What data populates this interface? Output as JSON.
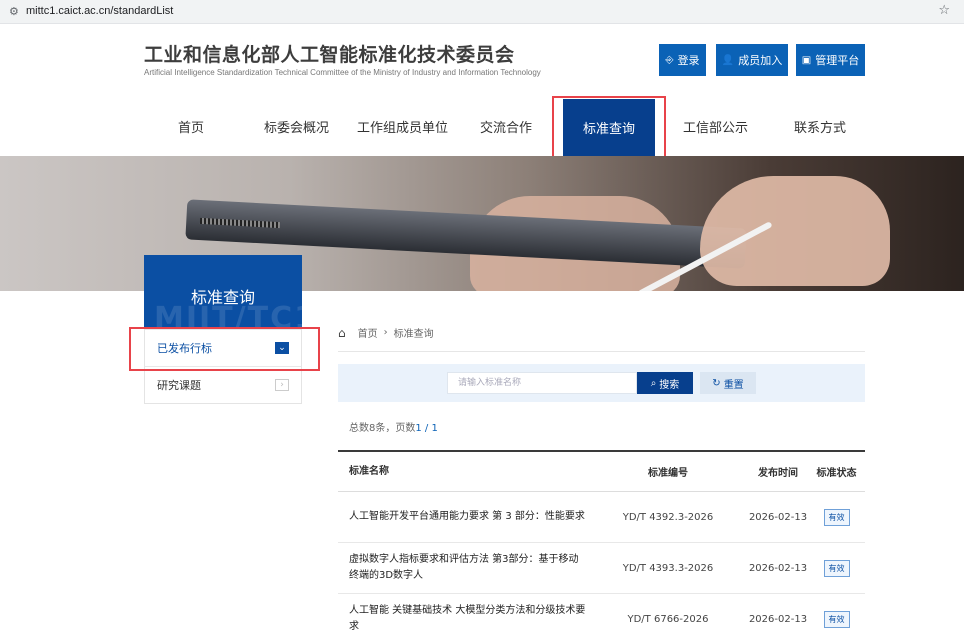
{
  "browser": {
    "url": "mittc1.caict.ac.cn/standardList"
  },
  "header": {
    "title": "工业和信息化部人工智能标准化技术委员会",
    "subtitle": "Artificial Intelligence Standardization Technical Committee of the Ministry of Industry and Information Technology",
    "buttons": {
      "login": "登录",
      "join": "成员加入",
      "admin": "管理平台"
    }
  },
  "nav": {
    "items": [
      "首页",
      "标委会概况",
      "工作组成员单位",
      "交流合作",
      "标准查询",
      "工信部公示",
      "联系方式"
    ],
    "active": "标准查询"
  },
  "side": {
    "title": "标准查询",
    "watermark": "MIIT/TC1",
    "items": [
      "已发布行标",
      "研究课题"
    ]
  },
  "breadcrumb": {
    "home": "首页",
    "sep": "›",
    "current": "标准查询"
  },
  "search": {
    "placeholder": "请输入标准名称",
    "search_label": "搜索",
    "reset_label": "重置"
  },
  "summary": {
    "text": "总数8条，页数",
    "pages": "1 / 1"
  },
  "table": {
    "headers": [
      "标准名称",
      "标准编号",
      "发布时间",
      "标准状态"
    ],
    "rows": [
      {
        "name": "人工智能开发平台通用能力要求 第 3 部分：性能要求",
        "code": "YD/T 4392.3-2026",
        "date": "2026-02-13",
        "status": "有效"
      },
      {
        "name": "虚拟数字人指标要求和评估方法 第3部分：基于移动终端的3D数字人",
        "code": "YD/T 4393.3-2026",
        "date": "2026-02-13",
        "status": "有效"
      },
      {
        "name": "人工智能 关键基础技术 大模型分类方法和分级技术要求",
        "code": "YD/T 6766-2026",
        "date": "2026-02-13",
        "status": "有效"
      }
    ]
  }
}
